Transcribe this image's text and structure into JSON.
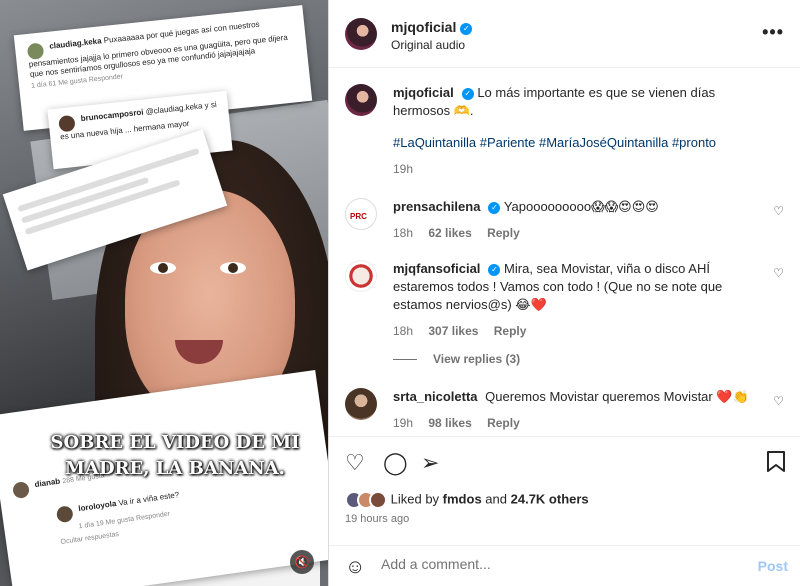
{
  "video": {
    "overlay_title": "SOBRE EL VIDEO DE MI MADRE, LA BANANA.",
    "card_top": {
      "user": "claudiag.keka",
      "text": "Puxaaaaaa por qué juegas así con nuestros pensamientos jajajja lo primero obveooo es una guagüita, pero que dijera que nos sentiríamos orgullosos eso ya me confundió jajajajajaja",
      "meta": "1 día   61 Me gusta   Responder"
    },
    "card_reply": {
      "user": "brunocamposroi",
      "text": "@claudiag.keka y si es una nueva hija ... hermana mayor"
    },
    "card_bottom": {
      "user1": "dianab",
      "meta1": "288 Me gusta",
      "user2": "loroloyola",
      "text2": "Va ir a viña este?",
      "meta2": "1 día   19 Me gusta   Responder",
      "hide": "Ocultar respuestas"
    },
    "mute_icon": "speaker-muted-icon"
  },
  "header": {
    "username": "mjqoficial",
    "subtitle": "Original audio",
    "more_icon": "more-horizontal-icon"
  },
  "caption": {
    "username": "mjqoficial",
    "text": "Lo más importante es que se vienen días hermosos 🫶.",
    "hashtags": "#LaQuintanilla #Pariente #MaríaJoséQuintanilla #pronto",
    "time": "19h"
  },
  "comments": [
    {
      "username": "prensachilena",
      "text": "Yapooooooooo😱😱😍😍😍",
      "time": "18h",
      "likes": "62 likes",
      "reply": "Reply"
    },
    {
      "username": "mjqfansoficial",
      "text": "Mira, sea Movistar, viña o disco AHÍ estaremos todos ! Vamos con todo ! (Que no se note que estamos nervios@s) 😂❤️",
      "time": "18h",
      "likes": "307 likes",
      "reply": "Reply"
    },
    {
      "username": "srta_nicoletta",
      "text": "Queremos Movistar queremos Movistar ❤️👏",
      "time": "19h",
      "likes": "98 likes",
      "reply": "Reply"
    }
  ],
  "view_replies": "View replies (3)",
  "actions": {
    "liked_by_prefix": "Liked by",
    "liked_by_user": "fmdos",
    "and": "and",
    "others": "24.7K others",
    "time_ago": "19 hours ago"
  },
  "add_comment": {
    "placeholder": "Add a comment...",
    "post_label": "Post"
  },
  "colors": {
    "link": "#00376b",
    "verified": "#0095f6",
    "post_disabled": "#a0c8f3",
    "heart_red": "#ed4956"
  }
}
